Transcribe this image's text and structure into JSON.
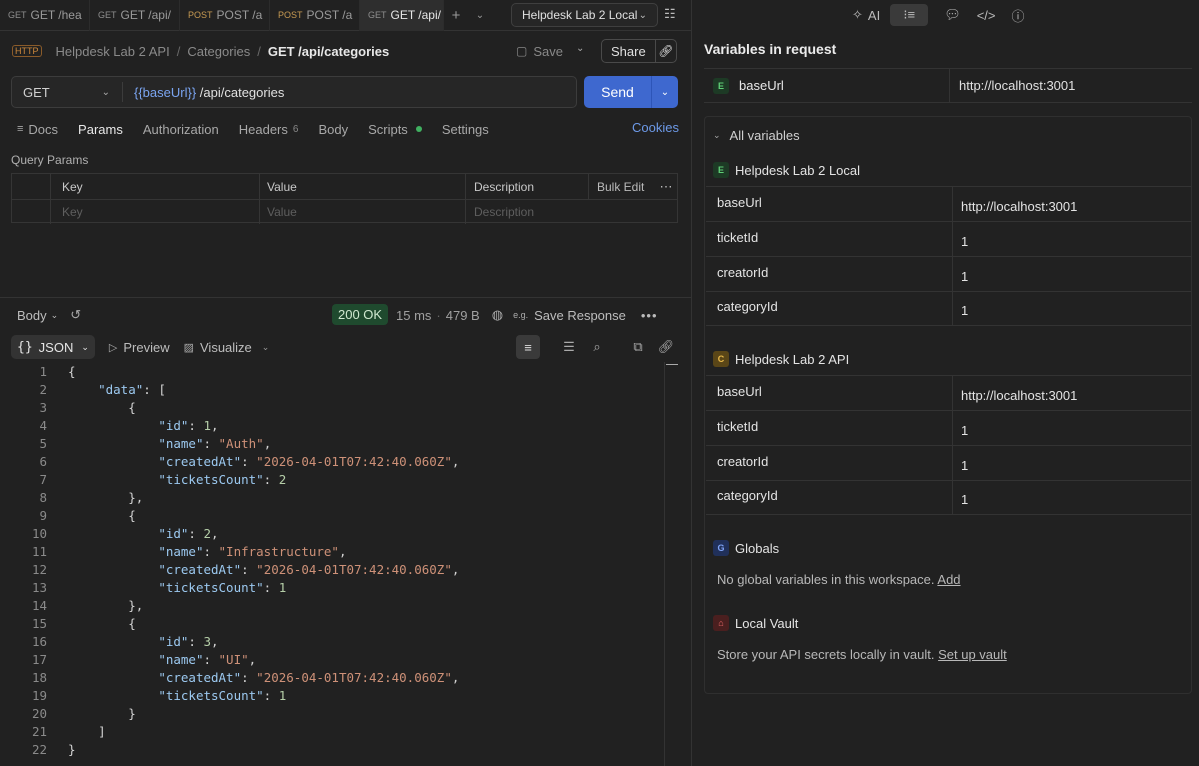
{
  "tabs": [
    {
      "method": "GET",
      "label": "GET /hea",
      "type": "get"
    },
    {
      "method": "GET",
      "label": "GET /api/",
      "type": "get"
    },
    {
      "method": "POST",
      "label": "POST /a",
      "type": "post"
    },
    {
      "method": "POST",
      "label": "POST /a",
      "type": "post"
    },
    {
      "method": "GET",
      "label": "GET /api/",
      "type": "get",
      "active": true
    }
  ],
  "environment": {
    "selected": "Helpdesk Lab 2 Local"
  },
  "breadcrumb": {
    "badge": "HTTP",
    "collection": "Helpdesk Lab 2 API",
    "folder": "Categories",
    "request": "GET /api/categories"
  },
  "toolbar": {
    "save_label": "Save",
    "share_label": "Share"
  },
  "request": {
    "method": "GET",
    "url_var": "{{baseUrl}}",
    "url_path": " /api/categories",
    "send_label": "Send",
    "cookies_label": "Cookies"
  },
  "request_tabs": {
    "docs": "Docs",
    "params": "Params",
    "authorization": "Authorization",
    "headers": "Headers",
    "headers_count": "6",
    "body": "Body",
    "scripts": "Scripts",
    "settings": "Settings"
  },
  "query_params": {
    "title": "Query Params",
    "headers": {
      "key": "Key",
      "value": "Value",
      "description": "Description",
      "bulk_edit": "Bulk Edit"
    },
    "placeholders": {
      "key": "Key",
      "value": "Value",
      "description": "Description"
    }
  },
  "response": {
    "body_label": "Body",
    "status": "200 OK",
    "time": "15 ms",
    "size": "479 B",
    "save_response": "Save Response",
    "format": "JSON",
    "format_brace": "{}",
    "preview": "Preview",
    "visualize": "Visualize",
    "line_numbers": [
      "1",
      "2",
      "3",
      "4",
      "5",
      "6",
      "7",
      "8",
      "9",
      "10",
      "11",
      "12",
      "13",
      "14",
      "15",
      "16",
      "17",
      "18",
      "19",
      "20",
      "21",
      "22"
    ],
    "categories": [
      {
        "id": "1",
        "name": "\"Auth\"",
        "createdAt": "\"2026-04-01T07:42:40.060Z\"",
        "ticketsCount": "2"
      },
      {
        "id": "2",
        "name": "\"Infrastructure\"",
        "createdAt": "\"2026-04-01T07:42:40.060Z\"",
        "ticketsCount": "1"
      },
      {
        "id": "3",
        "name": "\"UI\"",
        "createdAt": "\"2026-04-01T07:42:40.060Z\"",
        "ticketsCount": "1"
      }
    ]
  },
  "right_panel": {
    "ai_label": "AI",
    "title": "Variables in request",
    "request_var": {
      "badge": "E",
      "name": "baseUrl",
      "value": "http://localhost:3001"
    },
    "all_variables_label": "All variables",
    "local_env": {
      "badge": "E",
      "name": "Helpdesk Lab 2 Local",
      "vars": [
        {
          "name": "baseUrl",
          "value": "http://localhost:3001"
        },
        {
          "name": "ticketId",
          "value": "1"
        },
        {
          "name": "creatorId",
          "value": "1"
        },
        {
          "name": "categoryId",
          "value": "1"
        }
      ]
    },
    "collection": {
      "badge": "C",
      "name": "Helpdesk Lab 2 API",
      "vars": [
        {
          "name": "baseUrl",
          "value": "http://localhost:3001"
        },
        {
          "name": "ticketId",
          "value": "1"
        },
        {
          "name": "creatorId",
          "value": "1"
        },
        {
          "name": "categoryId",
          "value": "1"
        }
      ]
    },
    "globals": {
      "badge": "G",
      "name": "Globals",
      "note": "No global variables in this workspace.",
      "link": "Add"
    },
    "vault": {
      "name": "Local Vault",
      "note": "Store your API secrets locally in vault.",
      "link": "Set up vault"
    }
  }
}
